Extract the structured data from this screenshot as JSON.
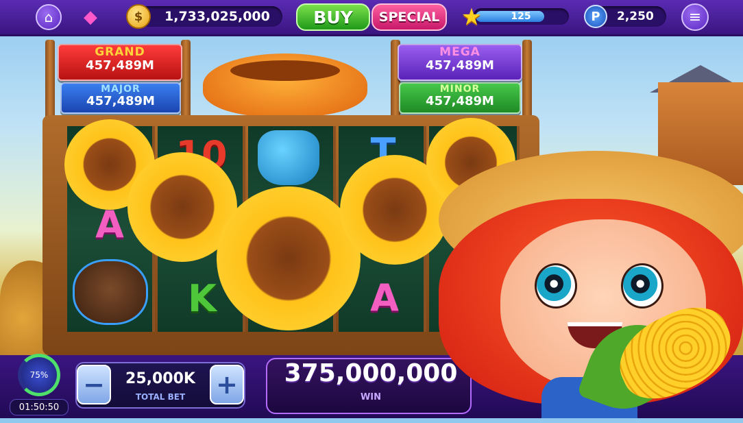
{
  "topbar": {
    "coin_balance": "1,733,025,000",
    "buy_label": "BUY",
    "special_label": "SPECIAL",
    "level_value": "125",
    "points_symbol": "P",
    "points_value": "2,250",
    "coin_symbol": "$"
  },
  "jackpots": [
    {
      "name": "GRAND",
      "value": "457,489M",
      "color": "#d42020"
    },
    {
      "name": "MAJOR",
      "value": "457,489M",
      "color": "#1f56c8"
    },
    {
      "name": "MEGA",
      "value": "457,489M",
      "color": "#7a3ad2"
    },
    {
      "name": "MINOR",
      "value": "457,489M",
      "color": "#2aa33a"
    }
  ],
  "reels": {
    "letters": {
      "ten": "10",
      "t": "T",
      "a1": "A",
      "k": "K",
      "a2": "A"
    }
  },
  "bottom": {
    "level_progress": "75%",
    "timer": "01:50:50",
    "minus_label": "−",
    "plus_label": "+",
    "bet_value": "25,000K",
    "bet_label": "TOTAL BET",
    "win_value": "375,000,000",
    "win_label": "WIN"
  },
  "icons": [
    "home-icon",
    "gem-badge-icon",
    "coin-icon",
    "star-icon",
    "points-icon",
    "menu-icon",
    "sunflower-icon",
    "watering-can-icon",
    "dog-icon",
    "pumpkin-icon"
  ]
}
